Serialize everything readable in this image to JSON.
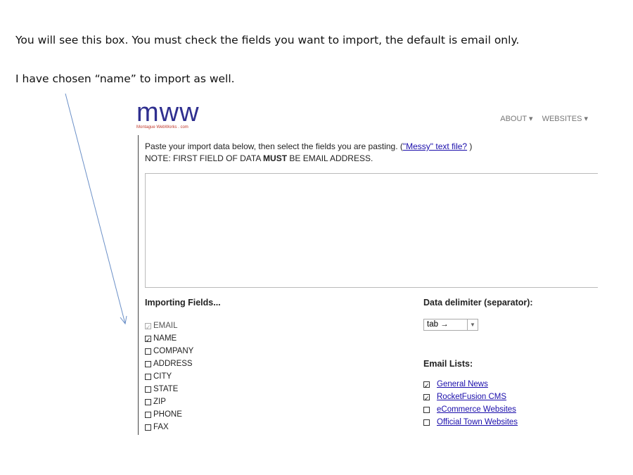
{
  "slide": {
    "line1": "You will see this box.  You must check the fields you want to import, the default is email only.",
    "line2": "I have chosen “name” to import as well."
  },
  "app": {
    "logo_text": "mww",
    "logo_sub": "Montague WebWorks . com",
    "nav": [
      "ABOUT ▾",
      "WEBSITES ▾"
    ],
    "brand_color": "#2f2f8f"
  },
  "intro": {
    "line1_prefix": "Paste your import data below, then select the fields you are pasting. (",
    "messy_link": "\"Messy\" text file?",
    "line1_suffix": " )",
    "note_prefix": "NOTE: FIRST FIELD OF DATA ",
    "note_bold": "MUST",
    "note_suffix": " BE EMAIL ADDRESS."
  },
  "paste_box": {
    "value": ""
  },
  "importing": {
    "title": "Importing Fields...",
    "fields": [
      {
        "label": "EMAIL",
        "checked": true,
        "disabled": true
      },
      {
        "label": "NAME",
        "checked": true,
        "disabled": false
      },
      {
        "label": "COMPANY",
        "checked": false,
        "disabled": false
      },
      {
        "label": "ADDRESS",
        "checked": false,
        "disabled": false
      },
      {
        "label": "CITY",
        "checked": false,
        "disabled": false
      },
      {
        "label": "STATE",
        "checked": false,
        "disabled": false
      },
      {
        "label": "ZIP",
        "checked": false,
        "disabled": false
      },
      {
        "label": "PHONE",
        "checked": false,
        "disabled": false
      },
      {
        "label": "FAX",
        "checked": false,
        "disabled": false
      }
    ]
  },
  "delimiter": {
    "title": "Data delimiter (separator):",
    "selected": "tab  →"
  },
  "email_lists": {
    "title": "Email Lists:",
    "items": [
      {
        "label": "General News",
        "checked": true
      },
      {
        "label": "RocketFusion CMS",
        "checked": true
      },
      {
        "label": "eCommerce Websites",
        "checked": false
      },
      {
        "label": "Official Town Websites",
        "checked": false
      }
    ]
  }
}
